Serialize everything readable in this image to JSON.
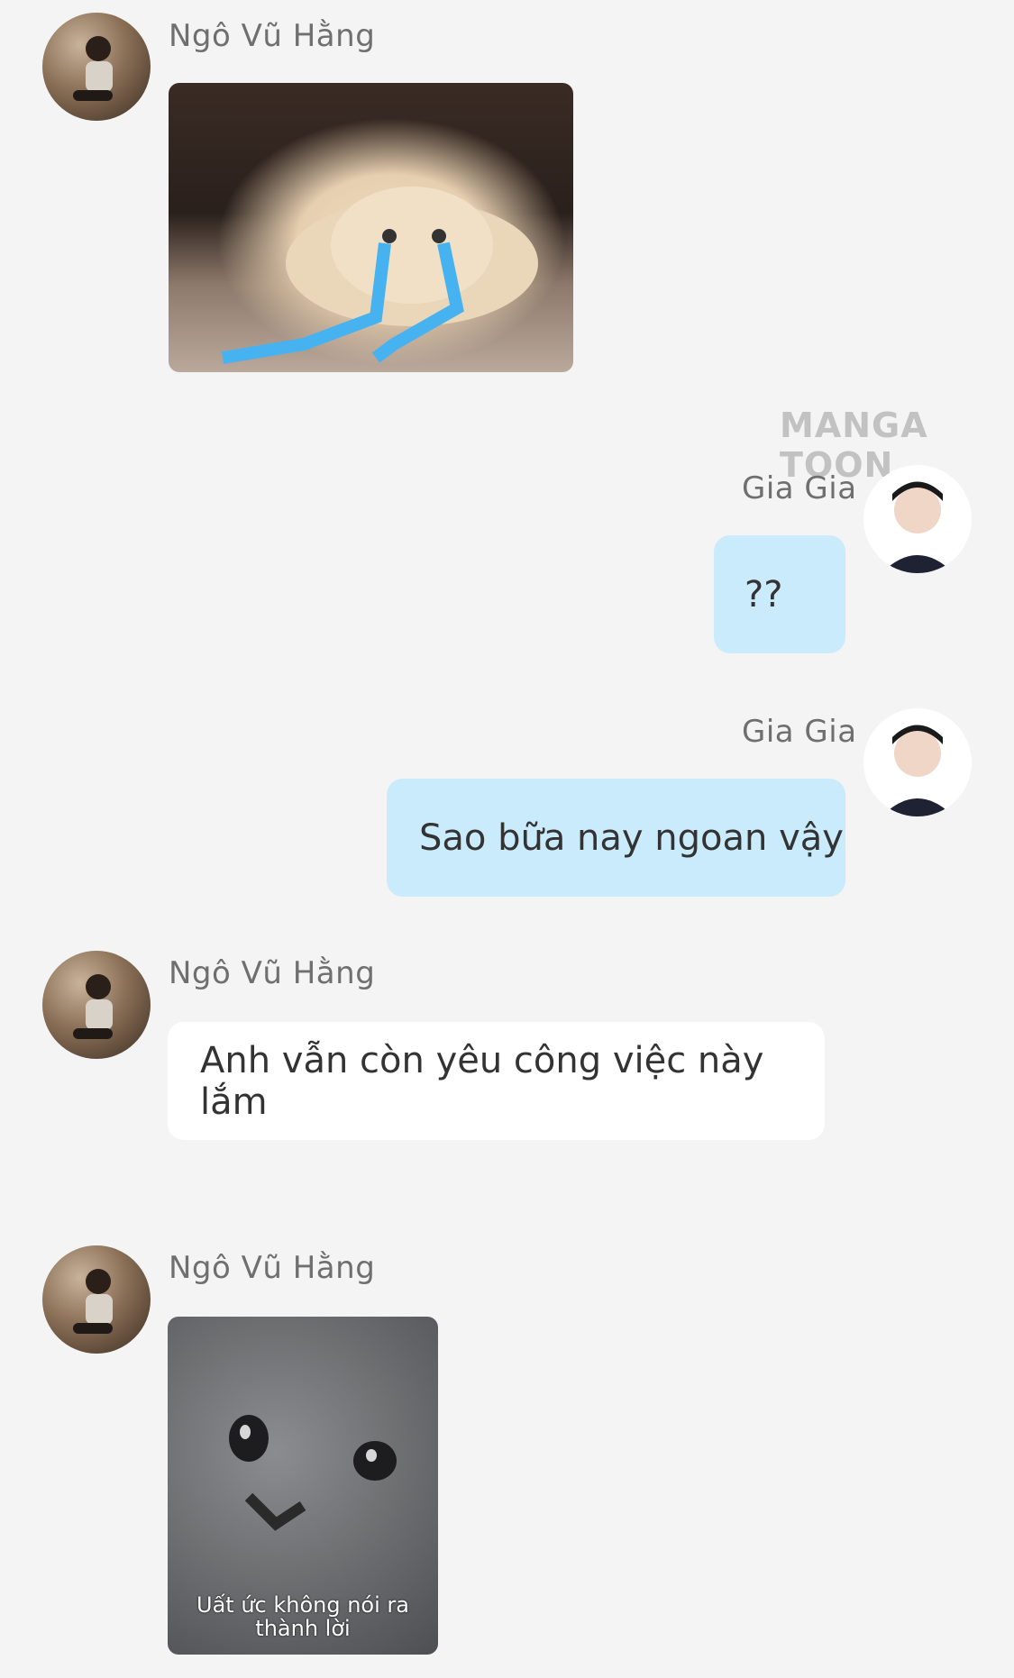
{
  "watermark": "MANGA TOON",
  "messages": [
    {
      "sender": "Ngô Vũ Hằng",
      "type": "image",
      "image": "crying-cat-sticker"
    },
    {
      "sender": "Gia Gia",
      "type": "text",
      "text": "??"
    },
    {
      "sender": "Gia Gia",
      "type": "text",
      "text": "Sao bữa nay ngoan vậy"
    },
    {
      "sender": "Ngô Vũ Hằng",
      "type": "text",
      "text": "Anh vẫn còn yêu công việc này lắm"
    },
    {
      "sender": "Ngô Vũ Hằng",
      "type": "image",
      "image": "sad-gray-cat-sticker",
      "caption_line1": "Uất ức không nói ra",
      "caption_line2": "thành lời"
    }
  ],
  "colors": {
    "background": "#f4f4f4",
    "bubble_blue": "#c9ebfb",
    "bubble_white": "#ffffff",
    "name_gray": "#6f6f6f"
  }
}
